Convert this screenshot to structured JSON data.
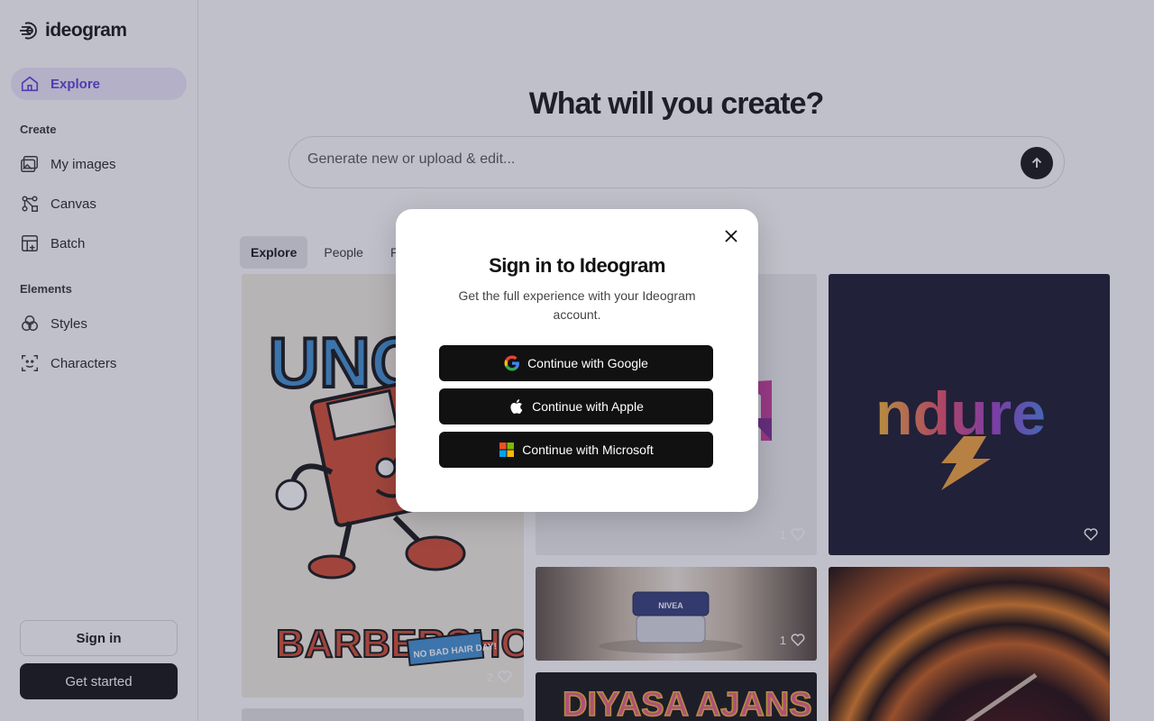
{
  "app": {
    "logo_text": "ideogram"
  },
  "sidebar": {
    "explore_label": "Explore",
    "create_section": "Create",
    "create_items": [
      {
        "label": "My images",
        "icon": "images-icon"
      },
      {
        "label": "Canvas",
        "icon": "canvas-icon"
      },
      {
        "label": "Batch",
        "icon": "batch-icon"
      }
    ],
    "elements_section": "Elements",
    "element_items": [
      {
        "label": "Styles",
        "icon": "styles-icon"
      },
      {
        "label": "Characters",
        "icon": "characters-icon"
      }
    ],
    "signin_label": "Sign in",
    "get_started_label": "Get started"
  },
  "main": {
    "headline": "What will you create?",
    "prompt_placeholder": "Generate new or upload & edit...",
    "tabs": [
      "Explore",
      "People",
      "Pro"
    ],
    "cards": [
      {
        "likes": "2",
        "texts": [
          "UNC",
          "BARBERSHOP",
          "NO BAD HAIR DAY!"
        ]
      },
      {
        "likes": "1"
      },
      {
        "likes": "",
        "texts": [
          "ndure"
        ]
      },
      {
        "likes": "1",
        "texts": [
          "NIVEA"
        ]
      },
      {
        "likes": "",
        "texts": [
          "DIYASA AJANS"
        ]
      },
      {
        "likes": ""
      }
    ]
  },
  "modal": {
    "title": "Sign in to Ideogram",
    "subtitle": "Get the full experience with your Ideogram account.",
    "google_label": "Continue with Google",
    "apple_label": "Continue with Apple",
    "microsoft_label": "Continue with Microsoft"
  },
  "colors": {
    "accent": "#5b3fd6",
    "dark": "#111111"
  }
}
